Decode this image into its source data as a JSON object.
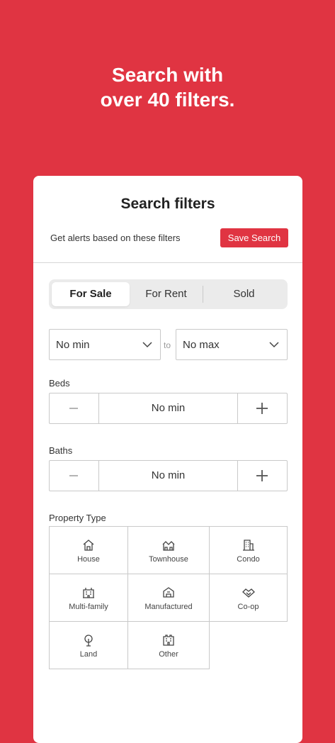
{
  "headline": {
    "line1": "Search with",
    "line2": "over 40 filters."
  },
  "card": {
    "title": "Search filters",
    "alerts_text": "Get alerts based on these filters",
    "save_label": "Save Search"
  },
  "listing_tabs": [
    {
      "label": "For Sale",
      "selected": true
    },
    {
      "label": "For Rent",
      "selected": false
    },
    {
      "label": "Sold",
      "selected": false
    }
  ],
  "price": {
    "min": "No min",
    "separator": "to",
    "max": "No max"
  },
  "beds": {
    "label": "Beds",
    "value": "No min"
  },
  "baths": {
    "label": "Baths",
    "value": "No min"
  },
  "property_type": {
    "label": "Property Type",
    "items": [
      {
        "label": "House",
        "icon": "house-icon"
      },
      {
        "label": "Townhouse",
        "icon": "townhouse-icon"
      },
      {
        "label": "Condo",
        "icon": "condo-icon"
      },
      {
        "label": "Multi-family",
        "icon": "multi-family-icon"
      },
      {
        "label": "Manufactured",
        "icon": "manufactured-icon"
      },
      {
        "label": "Co-op",
        "icon": "co-op-icon"
      },
      {
        "label": "Land",
        "icon": "land-icon"
      },
      {
        "label": "Other",
        "icon": "other-icon"
      }
    ]
  },
  "colors": {
    "brand": "#E03442",
    "card": "#FFFFFF",
    "border": "#C9C9C9"
  }
}
